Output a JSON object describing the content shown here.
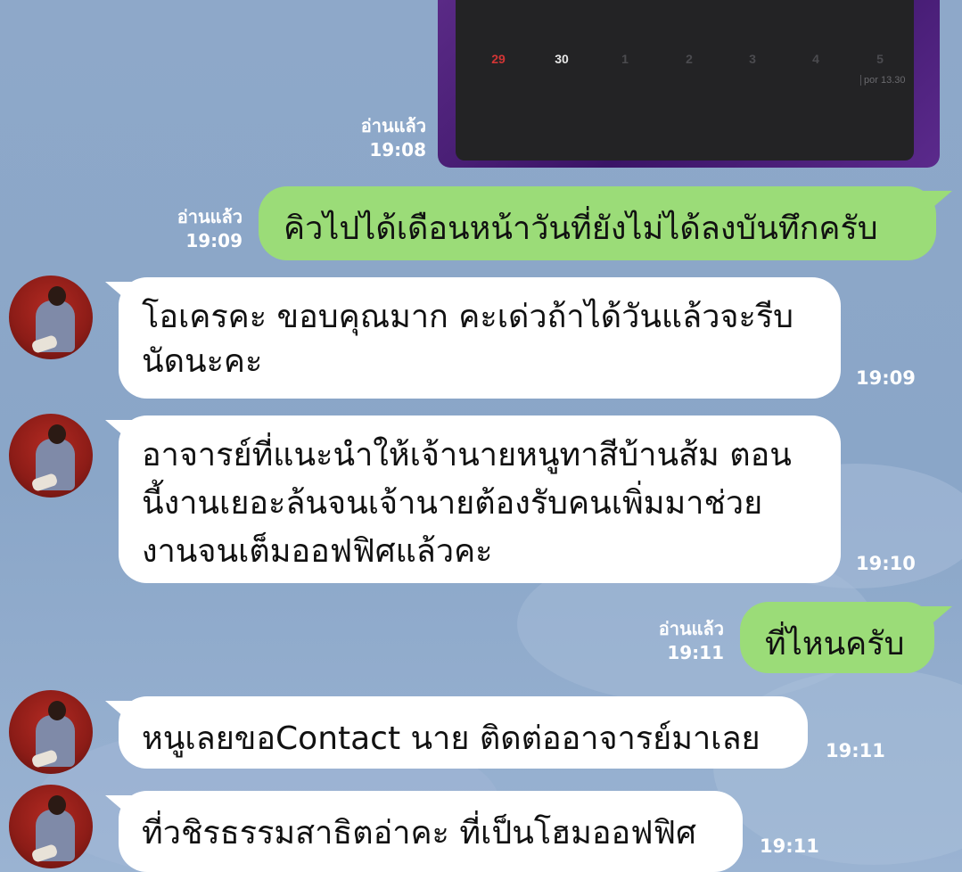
{
  "calendar": {
    "days": [
      "29",
      "30",
      "1",
      "2",
      "3",
      "4",
      "5"
    ],
    "note": "por 13.30"
  },
  "read_label": "อ่านแล้ว",
  "messages": [
    {
      "id": "m0",
      "side": "out",
      "kind": "image",
      "read": "อ่านแล้ว",
      "time": "19:08"
    },
    {
      "id": "m1",
      "side": "out",
      "text": "คิวไปได้เดือนหน้าวันที่ยังไม่ได้ลงบันทึกครับ",
      "read": "อ่านแล้ว",
      "time": "19:09"
    },
    {
      "id": "m2",
      "side": "in",
      "text": "โอเครคะ ขอบคุณมาก คะเด่วถ้าได้วันแล้วจะรีบ\nนัดนะคะ",
      "time": "19:09"
    },
    {
      "id": "m3",
      "side": "in",
      "text": "อาจารย์ที่แนะนำให้เจ้านายหนูทาสีบ้านส้ม ตอน\nนี้งานเยอะล้นจนเจ้านายต้องรับคนเพิ่มมาช่วย\nงานจนเต็มออฟฟิศแล้วคะ",
      "time": "19:10"
    },
    {
      "id": "m4",
      "side": "out",
      "text": "ที่ไหนครับ",
      "read": "อ่านแล้ว",
      "time": "19:11"
    },
    {
      "id": "m5",
      "side": "in",
      "text": "หนูเลยขอContact นาย ติดต่ออาจารย์มาเลย",
      "time": "19:11"
    },
    {
      "id": "m6",
      "side": "in",
      "text": "ที่วชิรธรรมสาธิตอ่าคะ ที่เป็นโฮมออฟฟิศ",
      "time": "19:11"
    }
  ],
  "colors": {
    "outgoing": "#9bdc78",
    "incoming": "#ffffff",
    "background": "#8ea8c9"
  }
}
